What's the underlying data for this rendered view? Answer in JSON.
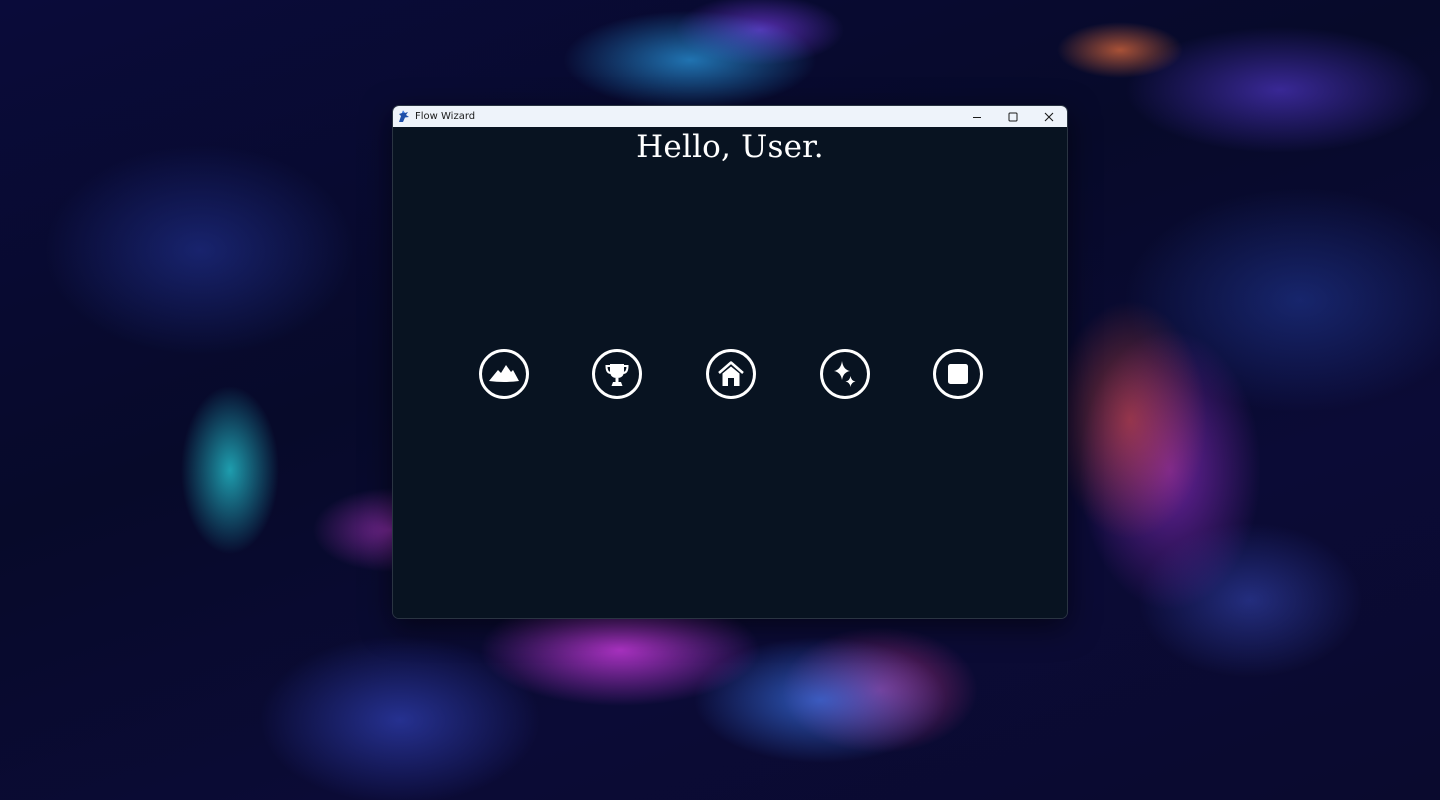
{
  "window": {
    "title": "Flow Wizard",
    "app_icon": "flow-wizard-app-icon",
    "controls": [
      "minimize-icon",
      "maximize-icon",
      "close-icon"
    ]
  },
  "main": {
    "greeting": "Hello, User.",
    "actions": [
      {
        "icon": "mountain-icon"
      },
      {
        "icon": "trophy-icon"
      },
      {
        "icon": "home-icon"
      },
      {
        "icon": "sparkles-icon"
      },
      {
        "icon": "square-icon"
      }
    ]
  },
  "colors": {
    "window_background": "#081321",
    "titlebar_background": "#eef3fa",
    "icon_color": "#ffffff",
    "text_color": "#ffffff"
  }
}
